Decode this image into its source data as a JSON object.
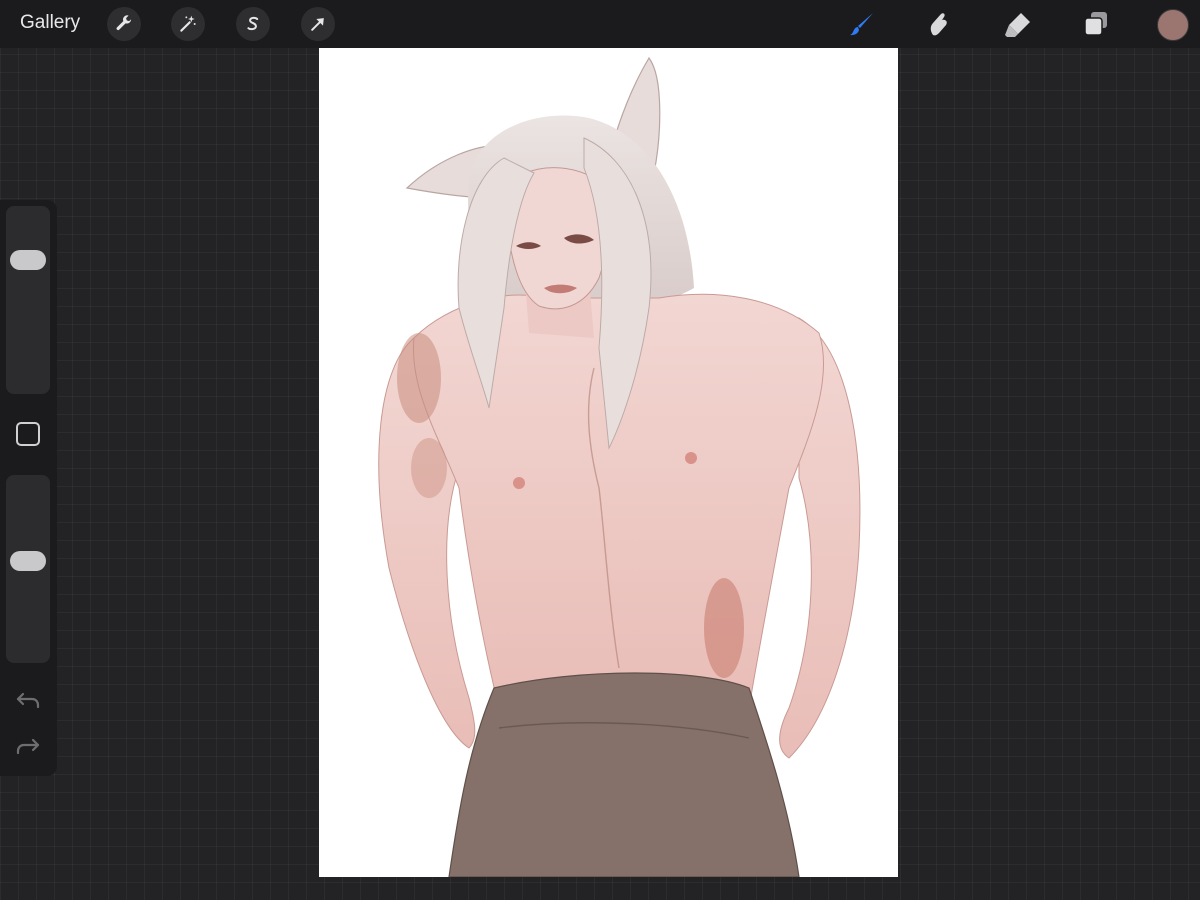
{
  "app": {
    "gallery_label": "Gallery",
    "accent_color": "#2f7bf5",
    "current_color": "#9b7670"
  },
  "toolbar_left": [
    {
      "name": "actions",
      "icon": "wrench-icon"
    },
    {
      "name": "adjustments",
      "icon": "magic-wand-icon"
    },
    {
      "name": "selection",
      "icon": "selection-s-icon"
    },
    {
      "name": "transform",
      "icon": "arrow-cursor-icon"
    }
  ],
  "toolbar_right": [
    {
      "name": "brush",
      "icon": "brush-icon",
      "active": true
    },
    {
      "name": "smudge",
      "icon": "smudge-finger-icon",
      "active": false
    },
    {
      "name": "eraser",
      "icon": "eraser-icon",
      "active": false
    },
    {
      "name": "layers",
      "icon": "layers-icon",
      "active": false
    }
  ],
  "sidebar": {
    "brush_size_level": 0.75,
    "opacity_level": 0.55,
    "modify_icon": "square-icon",
    "undo_icon": "undo-arrow-icon",
    "redo_icon": "redo-arrow-icon"
  },
  "artwork": {
    "subject": "illustration-canvas"
  }
}
